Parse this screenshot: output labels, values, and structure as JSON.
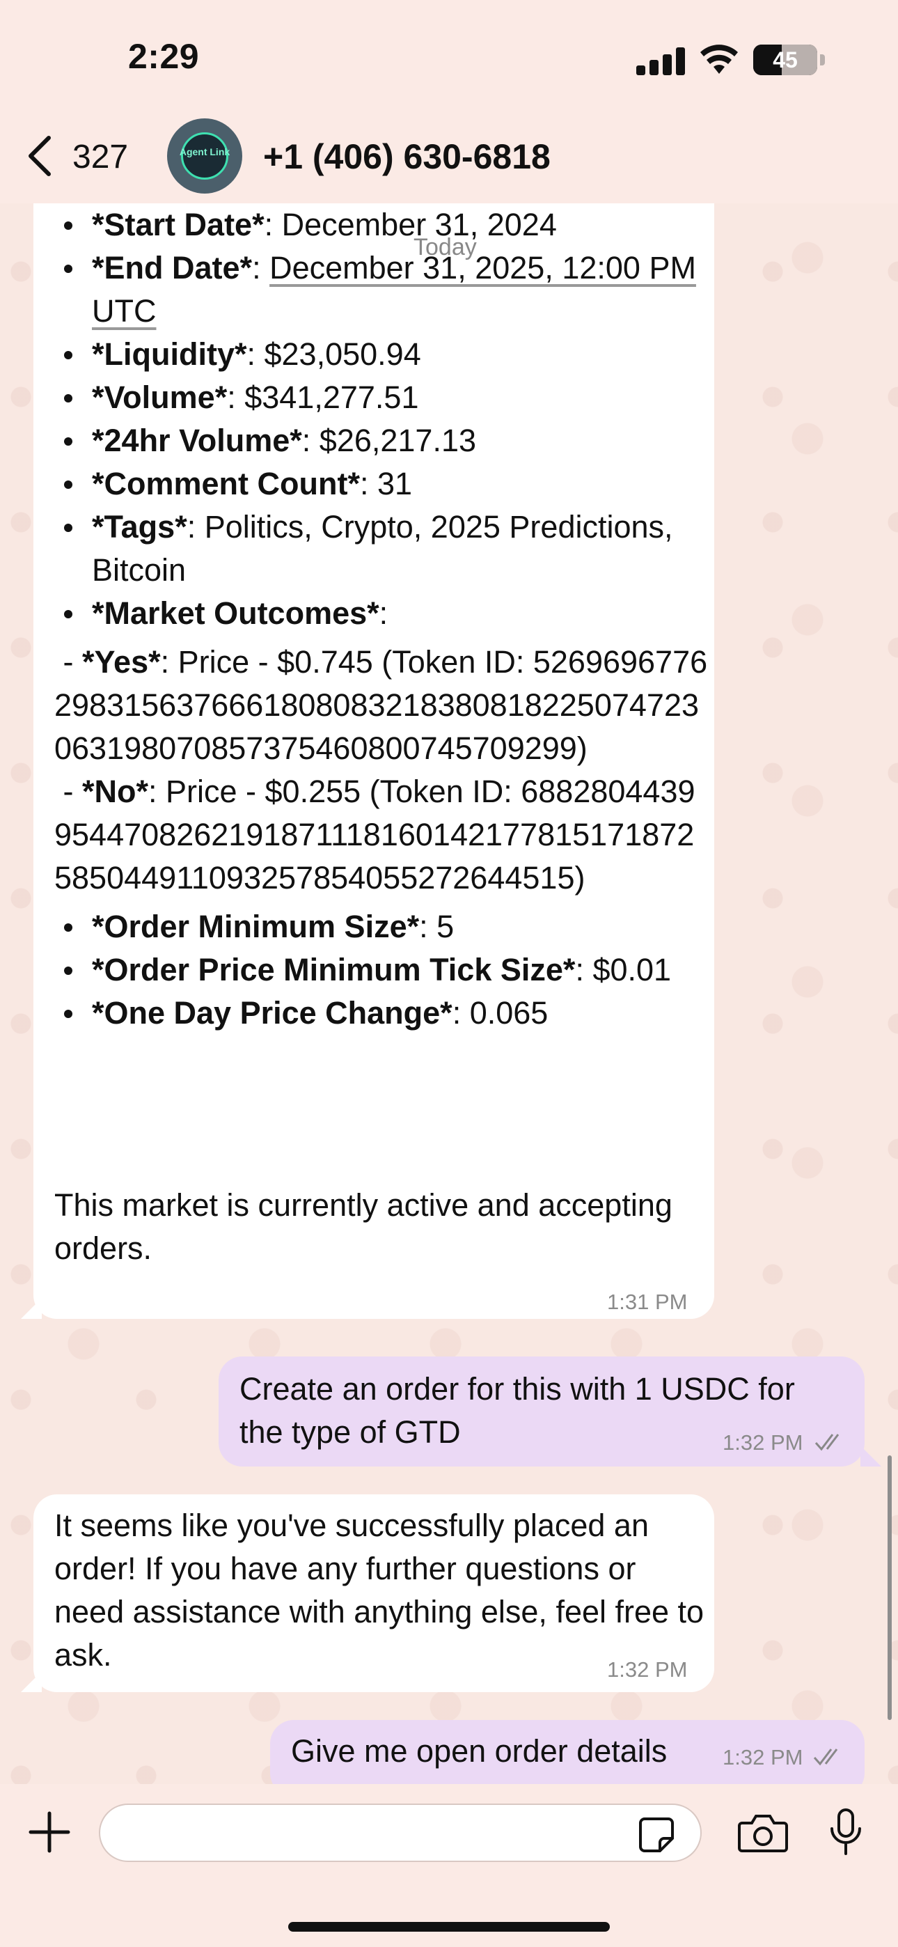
{
  "status_bar": {
    "time": "2:29",
    "battery": "45",
    "battery_level": 0.45
  },
  "header": {
    "back_count": "327",
    "avatar_text": "Agent Link",
    "contact": "+1 (406) 630-6818"
  },
  "date_divider": "Today",
  "market_message": {
    "start_date_label": "*Start Date*",
    "start_date_value": ": December 31, 2024",
    "end_date_label": "*End Date*",
    "end_date_value": ": ",
    "end_date_link": "December 31, 2025, 12:00 PM UTC",
    "liquidity_label": "*Liquidity*",
    "liquidity_value": ": $23,050.94",
    "volume_label": "*Volume*",
    "volume_value": ": $341,277.51",
    "volume24_label": "*24hr Volume*",
    "volume24_value": ": $26,217.13",
    "comments_label": "*Comment Count*",
    "comments_value": ": 31",
    "tags_label": "*Tags*",
    "tags_value": ": Politics, Crypto, 2025 Predictions, Bitcoin",
    "outcomes_label": "*Market Outcomes*",
    "outcomes_value": ":",
    "yes_prefix": " - ",
    "yes_label": "*Yes*",
    "yes_value": ": Price - $0.745 (Token ID: 52696967762983156376661808083218380818225074723063198070857375460800745709299)",
    "no_prefix": " - ",
    "no_label": "*No*",
    "no_value": ": Price - $0.255 (Token ID: 68828044399544708262191871118160142177815171872585044911093257854055272644515)",
    "min_size_label": "*Order Minimum Size*",
    "min_size_value": ": 5",
    "tick_label": "*Order Price Minimum Tick Size*",
    "tick_value": ": $0.01",
    "change_label": "*One Day Price Change*",
    "change_value": ": 0.065",
    "note": "This market is currently active and accepting orders.",
    "time": "1:31 PM"
  },
  "messages": [
    {
      "text": "Create an order for this with 1 USDC for the type of GTD",
      "time": "1:32 PM"
    },
    {
      "text": "It seems like you've successfully placed an order! If you have any further questions or need assistance with anything else, feel free to ask.",
      "time": "1:32 PM"
    },
    {
      "text": "Give me open order details",
      "time": "1:32 PM"
    }
  ],
  "composer": {
    "placeholder": ""
  },
  "colors": {
    "incoming": "#ffffff",
    "outgoing": "#ebd9f5",
    "wallpaper": "#f9e8e2"
  },
  "icons": [
    "back-chevron-icon",
    "plus-icon",
    "sticker-icon",
    "camera-icon",
    "microphone-icon",
    "read-checks-icon",
    "signal-icon",
    "wifi-icon",
    "battery-icon"
  ]
}
